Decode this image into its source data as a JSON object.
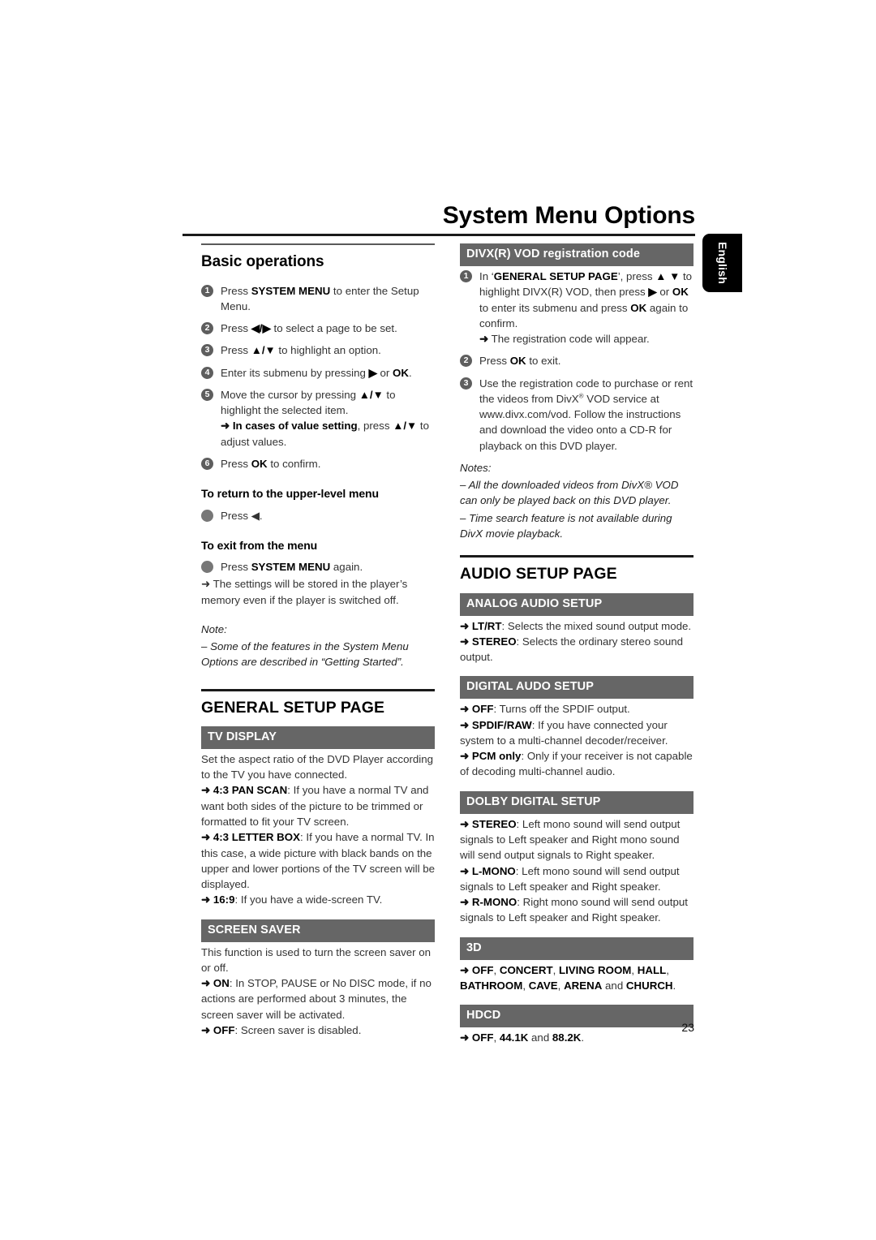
{
  "document": {
    "title": "System Menu Options",
    "page_number": "23",
    "language_tab": "English"
  },
  "left_column": {
    "basic_operations": {
      "heading": "Basic operations",
      "steps": [
        {
          "num": "1",
          "html": "Press <b class=\"b\">SYSTEM MENU</b> to enter the Setup Menu."
        },
        {
          "num": "2",
          "html": "Press <b class=\"b\">◀/▶</b> to select a page to be set."
        },
        {
          "num": "3",
          "html": "Press <b class=\"b\">▲/▼</b> to highlight an option."
        },
        {
          "num": "4",
          "html": "Enter its submenu by pressing <b class=\"b\">▶</b> or <b class=\"b\">OK</b>."
        },
        {
          "num": "5",
          "html": "Move the cursor by pressing <b class=\"b\">▲/▼</b> to highlight the selected item.<br><span class=\"arrow\">➜</span> <b class=\"b\">In cases of value setting</b>, press <b class=\"b\">▲/▼</b> to adjust values."
        },
        {
          "num": "6",
          "html": "Press <b class=\"b\">OK</b> to confirm."
        }
      ],
      "return_heading": "To return to the upper-level menu",
      "return_item": "Press ◀.",
      "exit_heading": "To exit from the menu",
      "exit_item": "Press <b class=\"b\">SYSTEM MENU</b> again.",
      "exit_arrow": "➜ The settings will be stored in the player’s memory even if the player is switched off.",
      "note_label": "Note:",
      "note_text": "–  Some of the features in the System Menu Options are described in “Getting Started”."
    },
    "general_setup_page": {
      "heading": "GENERAL SETUP PAGE",
      "sections": [
        {
          "bar": "TV DISPLAY",
          "body_html": "Set the aspect ratio of the DVD Player according to the TV you have connected.<br><span class=\"arrow\">➜</span> <b class=\"b\">4:3 PAN SCAN</b>: If you have a normal TV and want both sides of the picture to be trimmed or formatted to fit your TV screen.<br><span class=\"arrow\">➜</span> <b class=\"b\">4:3 LETTER BOX</b>: If you have a normal TV. In this case, a wide picture with black bands on the upper and lower portions of the TV screen will be displayed.<br><span class=\"arrow\">➜</span> <b class=\"b\">16:9</b>: If you have a wide-screen TV."
        },
        {
          "bar": "SCREEN SAVER",
          "body_html": "This function is used to turn the screen saver on or off.<br><span class=\"arrow\">➜</span> <b class=\"b\">ON</b>: In STOP, PAUSE or No DISC mode, if no actions are performed about 3 minutes, the screen saver will be activated.<br><span class=\"arrow\">➜</span> <b class=\"b\">OFF</b>: Screen saver is disabled."
        }
      ]
    }
  },
  "right_column": {
    "divx_vod": {
      "bar": "DIVX(R) VOD registration code",
      "steps": [
        {
          "num": "1",
          "html": "In ‘<b class=\"b\">GENERAL SETUP PAGE</b>’, press <b class=\"b\">▲ ▼</b> to highlight DIVX(R) VOD, then press <b class=\"b\">▶</b> or <b class=\"b\">OK</b> to enter its submenu and press <b class=\"b\">OK</b> again to confirm.<br><span class=\"arrow\">➜</span> The registration code will appear."
        },
        {
          "num": "2",
          "html": "Press <b class=\"b\">OK</b> to exit."
        },
        {
          "num": "3",
          "html": "Use the registration code to purchase or rent the videos from DivX<span class=\"sup\">®</span> VOD service at www.divx.com/vod. Follow the instructions and download the video onto a CD-R for playback on this DVD player."
        }
      ],
      "notes_label": "Notes:",
      "notes": [
        "–  All the downloaded videos from DivX® VOD can only be played back on this DVD player.",
        "–  Time search feature is not available during DivX movie playback."
      ]
    },
    "audio_setup_page": {
      "heading": "AUDIO SETUP PAGE",
      "sections": [
        {
          "bar": "ANALOG AUDIO SETUP",
          "body_html": "<span class=\"arrow\">➜</span> <b class=\"b\">LT/RT</b>: Selects the mixed sound output mode.<br><span class=\"arrow\">➜</span> <b class=\"b\">STEREO</b>: Selects the ordinary stereo sound output."
        },
        {
          "bar": "DIGITAL AUDO SETUP",
          "body_html": "<span class=\"arrow\">➜</span> <b class=\"b\">OFF</b>: Turns off the SPDIF output.<br><span class=\"arrow\">➜</span> <b class=\"b\">SPDIF/RAW</b>: If you have connected your system to a multi-channel decoder/receiver.<br><span class=\"arrow\">➜</span> <b class=\"b\">PCM only</b>: Only if your receiver is not capable of decoding multi-channel audio."
        },
        {
          "bar": "DOLBY DIGITAL SETUP",
          "body_html": "<span class=\"arrow\">➜</span> <b class=\"b\">STEREO</b>: Left mono sound will send output signals to Left speaker and Right mono sound will send output signals to Right speaker.<br><span class=\"arrow\">➜</span> <b class=\"b\">L-MONO</b>: Left mono sound will send output signals to Left speaker and Right speaker.<br><span class=\"arrow\">➜</span> <b class=\"b\">R-MONO</b>: Right mono sound will send output signals to Left speaker and Right speaker."
        },
        {
          "bar": "3D",
          "body_html": "<span class=\"arrow\">➜</span> <b class=\"b\">OFF</b>, <b class=\"b\">CONCERT</b>, <b class=\"b\">LIVING ROOM</b>, <b class=\"b\">HALL</b>, <b class=\"b\">BATHROOM</b>, <b class=\"b\">CAVE</b>, <b class=\"b\">ARENA</b> and <b class=\"b\">CHURCH</b>."
        },
        {
          "bar": "HDCD",
          "body_html": "<span class=\"arrow\">➜</span> <b class=\"b\">OFF</b>, <b class=\"b\">44.1K</b> and <b class=\"b\">88.2K</b>."
        }
      ]
    }
  }
}
